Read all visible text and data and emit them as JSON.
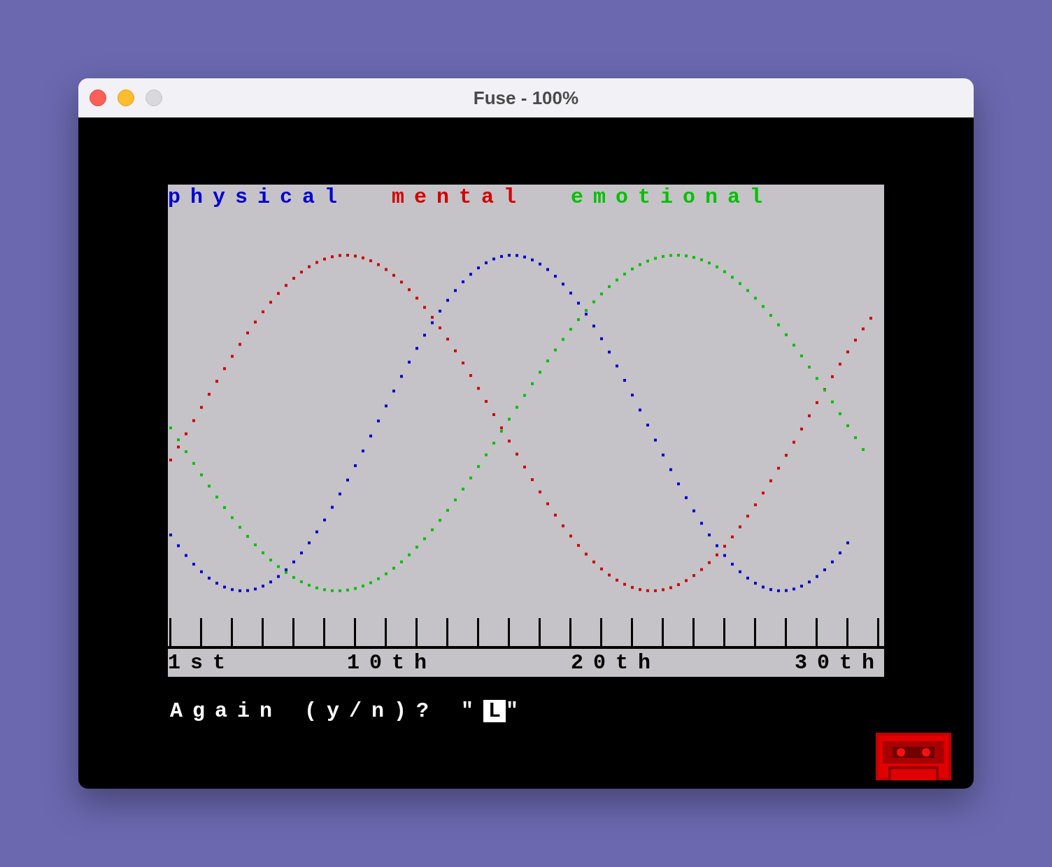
{
  "window": {
    "title": "Fuse - 100%"
  },
  "chart": {
    "legend": [
      {
        "label": "physical",
        "color": "#0000d0"
      },
      {
        "label": "mental",
        "color": "#d00000"
      },
      {
        "label": "emotional",
        "color": "#00c000"
      }
    ],
    "axis_labels": [
      "1st",
      "10th",
      "20th",
      "30th"
    ]
  },
  "prompt": {
    "text": "Again (y/n)? \"",
    "cursor": "L",
    "closing": "\""
  }
}
